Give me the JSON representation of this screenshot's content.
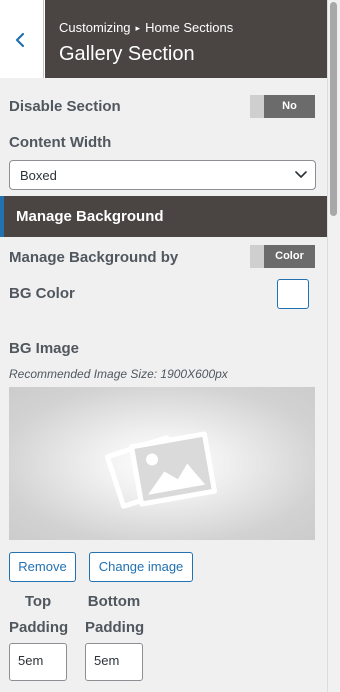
{
  "header": {
    "breadcrumb_root": "Customizing",
    "breadcrumb_separator": "▸",
    "breadcrumb_parent": "Home Sections",
    "title": "Gallery Section",
    "back_icon": "chevron-left-icon"
  },
  "disable_section": {
    "label": "Disable Section",
    "value": "No"
  },
  "content_width": {
    "label": "Content Width",
    "selected": "Boxed",
    "icon": "chevron-down-icon"
  },
  "manage_background_heading": "Manage Background",
  "manage_background_by": {
    "label": "Manage Background by",
    "value": "Color"
  },
  "bg_color": {
    "label": "BG Color",
    "value": "#ffffff"
  },
  "bg_image": {
    "label": "BG Image",
    "note": "Recommended Image Size: 1900X600px",
    "placeholder_icon": "image-placeholder-icon",
    "remove_label": "Remove",
    "change_label": "Change image"
  },
  "padding": {
    "top_label_line1": "Top",
    "top_label_line2": "Padding",
    "top_value": "5em",
    "bottom_label_line1": "Bottom",
    "bottom_label_line2": "Padding",
    "bottom_value": "5em"
  },
  "colors": {
    "accent": "#2271b1",
    "header_bg": "#4a4443",
    "panel_bg": "#f0f0f1"
  }
}
